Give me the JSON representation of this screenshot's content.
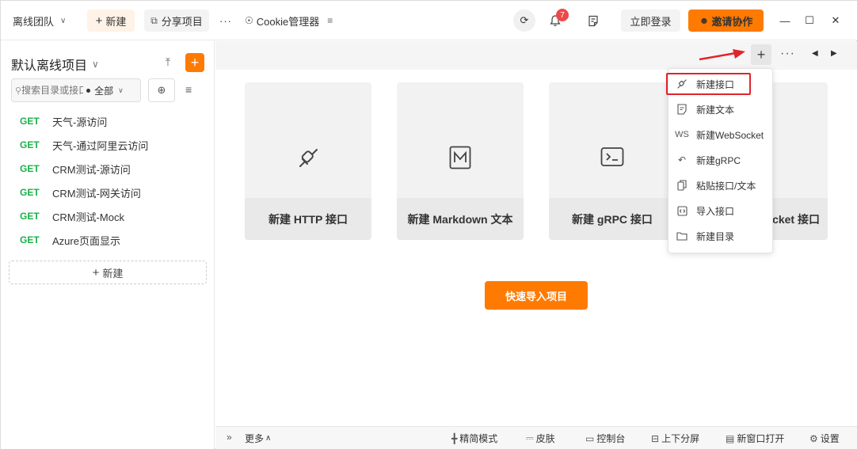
{
  "topbar": {
    "team": "离线团队",
    "new_label": "新建",
    "share_label": "分享项目",
    "more": "···",
    "cookie_label": "Cookie管理器",
    "notification_count": "7",
    "login_label": "立即登录",
    "invite_label": "邀请协作"
  },
  "sidebar": {
    "project_title": "默认离线项目",
    "search_placeholder": "搜索目录或接口",
    "filter_value": "全部",
    "apis": [
      {
        "method": "GET",
        "name": "天气-源访问"
      },
      {
        "method": "GET",
        "name": "天气-通过阿里云访问"
      },
      {
        "method": "GET",
        "name": "CRM测试-源访问"
      },
      {
        "method": "GET",
        "name": "CRM测试-网关访问"
      },
      {
        "method": "GET",
        "name": "CRM测试-Mock"
      },
      {
        "method": "GET",
        "name": "Azure页面显示"
      }
    ],
    "new_label": "新建"
  },
  "main": {
    "cards": [
      {
        "label": "新建 HTTP 接口",
        "icon": "plug-icon"
      },
      {
        "label": "新建 Markdown 文本",
        "icon": "markdown-icon"
      },
      {
        "label": "新建 gRPC 接口",
        "icon": "terminal-icon"
      },
      {
        "label": "cket 接口",
        "icon": "websocket-icon"
      }
    ],
    "quick_import_label": "快速导入项目"
  },
  "menu": {
    "items": [
      {
        "label": "新建接口",
        "icon": "plug-icon"
      },
      {
        "label": "新建文本",
        "icon": "document-icon"
      },
      {
        "label": "新建WebSocket",
        "icon": "ws-icon"
      },
      {
        "label": "新建gRPC",
        "icon": "grpc-icon"
      },
      {
        "label": "粘贴接口/文本",
        "icon": "paste-icon"
      },
      {
        "label": "导入接口",
        "icon": "import-icon"
      },
      {
        "label": "新建目录",
        "icon": "folder-icon"
      }
    ]
  },
  "footer": {
    "more_label": "更多",
    "simple_mode": "精简模式",
    "skin": "皮肤",
    "console": "控制台",
    "split": "上下分屏",
    "new_window": "新窗口打开",
    "settings": "设置"
  },
  "colors": {
    "accent": "#ff7a00",
    "get_method": "#1ab14a",
    "badge": "#f04848",
    "highlight_border": "#e0242b"
  }
}
